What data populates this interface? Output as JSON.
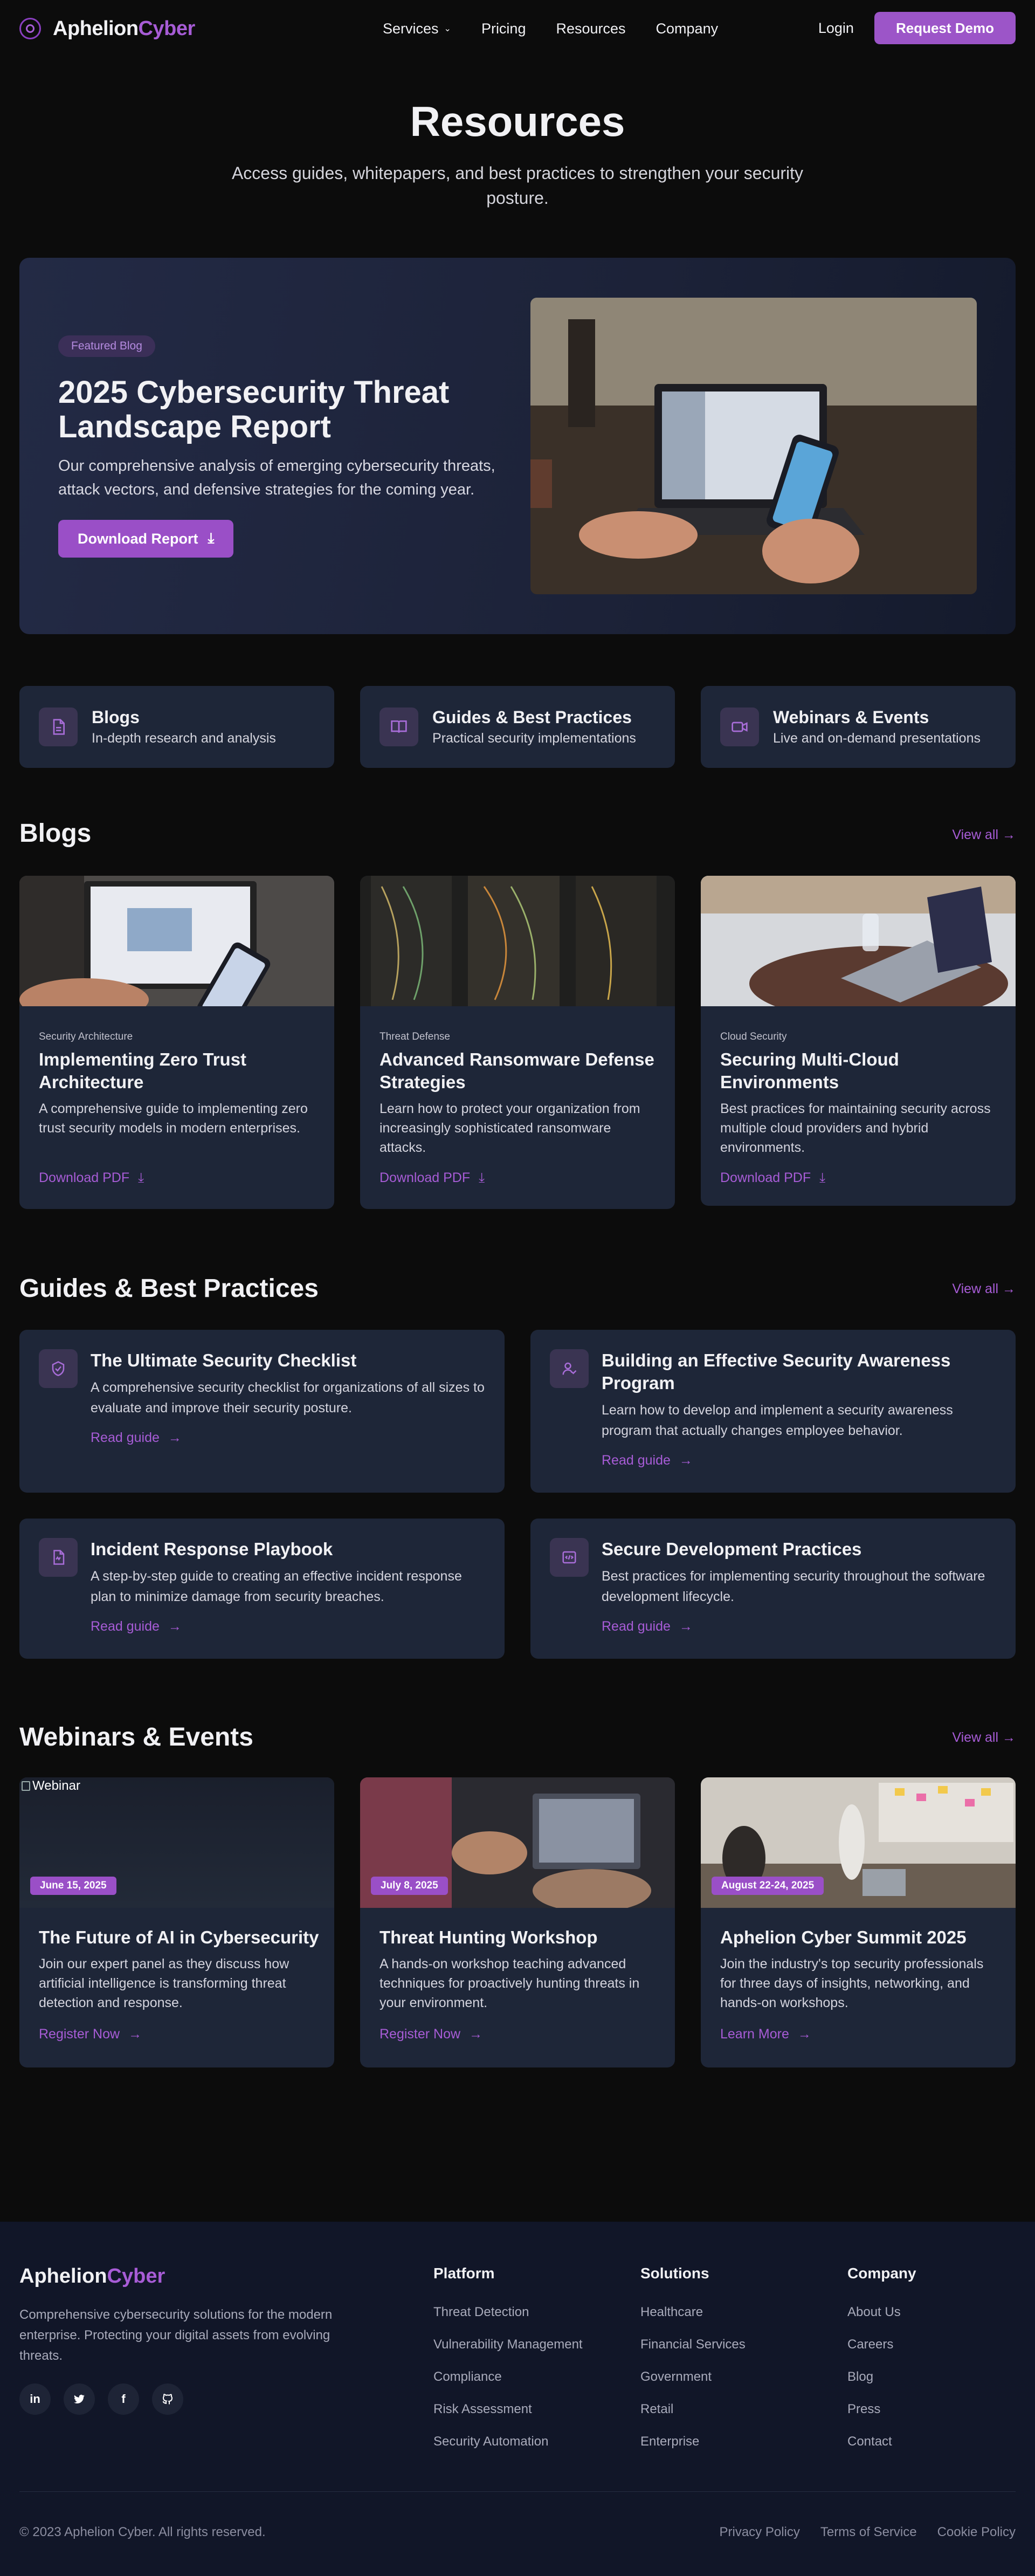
{
  "nav": {
    "brand_a": "Aphelion",
    "brand_b": "Cyber",
    "links": [
      "Services",
      "Pricing",
      "Resources",
      "Company"
    ],
    "login": "Login",
    "cta": "Request Demo"
  },
  "hero": {
    "title": "Resources",
    "subtitle": "Access guides, whitepapers, and best practices to strengthen your security posture."
  },
  "featured": {
    "badge": "Featured Blog",
    "title": "2025 Cybersecurity Threat Landscape Report",
    "description": "Our comprehensive analysis of emerging cybersecurity threats, attack vectors, and defensive strategies for the coming year.",
    "button": "Download Report"
  },
  "categories": [
    {
      "title": "Blogs",
      "subtitle": "In-depth research and analysis",
      "icon": "document-icon"
    },
    {
      "title": "Guides & Best Practices",
      "subtitle": "Practical security implementations",
      "icon": "book-icon"
    },
    {
      "title": "Webinars & Events",
      "subtitle": "Live and on-demand presentations",
      "icon": "video-icon"
    }
  ],
  "blogs": {
    "heading": "Blogs",
    "view_all": "View all",
    "items": [
      {
        "category": "Security Architecture",
        "title": "Implementing Zero Trust Architecture",
        "description": "A comprehensive guide to implementing zero trust security models in modern enterprises.",
        "link": "Download PDF"
      },
      {
        "category": "Threat Defense",
        "title": "Advanced Ransomware Defense Strategies",
        "description": "Learn how to protect your organization from increasingly sophisticated ransomware attacks.",
        "link": "Download PDF"
      },
      {
        "category": "Cloud Security",
        "title": "Securing Multi-Cloud Environments",
        "description": "Best practices for maintaining security across multiple cloud providers and hybrid environments.",
        "link": "Download PDF"
      }
    ]
  },
  "guides": {
    "heading": "Guides & Best Practices",
    "view_all": "View all",
    "items": [
      {
        "title": "The Ultimate Security Checklist",
        "description": "A comprehensive security checklist for organizations of all sizes to evaluate and improve their security posture.",
        "link": "Read guide",
        "icon": "shield-check-icon"
      },
      {
        "title": "Building an Effective Security Awareness Program",
        "description": "Learn how to develop and implement a security awareness program that actually changes employee behavior.",
        "link": "Read guide",
        "icon": "user-icon"
      },
      {
        "title": "Incident Response Playbook",
        "description": "A step-by-step guide to creating an effective incident response plan to minimize damage from security breaches.",
        "link": "Read guide",
        "icon": "file-icon"
      },
      {
        "title": "Secure Development Practices",
        "description": "Best practices for implementing security throughout the software development lifecycle.",
        "link": "Read guide",
        "icon": "code-icon"
      }
    ]
  },
  "events": {
    "heading": "Webinars & Events",
    "view_all": "View all",
    "items": [
      {
        "date": "June 15, 2025",
        "title": "The Future of AI in Cybersecurity",
        "description": "Join our expert panel as they discuss how artificial intelligence is transforming threat detection and response.",
        "link": "Register Now",
        "image_alt": "Webinar"
      },
      {
        "date": "July 8, 2025",
        "title": "Threat Hunting Workshop",
        "description": "A hands-on workshop teaching advanced techniques for proactively hunting threats in your environment.",
        "link": "Register Now"
      },
      {
        "date": "August 22-24, 2025",
        "title": "Aphelion Cyber Summit 2025",
        "description": "Join the industry's top security professionals for three days of insights, networking, and hands-on workshops.",
        "link": "Learn More"
      }
    ]
  },
  "footer": {
    "brand_a": "Aphelion",
    "brand_b": "Cyber",
    "description": "Comprehensive cybersecurity solutions for the modern enterprise. Protecting your digital assets from evolving threats.",
    "socials": [
      "in",
      "twitter",
      "f",
      "github"
    ],
    "columns": [
      {
        "title": "Platform",
        "links": [
          "Threat Detection",
          "Vulnerability Management",
          "Compliance",
          "Risk Assessment",
          "Security Automation"
        ]
      },
      {
        "title": "Solutions",
        "links": [
          "Healthcare",
          "Financial Services",
          "Government",
          "Retail",
          "Enterprise"
        ]
      },
      {
        "title": "Company",
        "links": [
          "About Us",
          "Careers",
          "Blog",
          "Press",
          "Contact"
        ]
      }
    ],
    "copyright": "© 2023 Aphelion Cyber. All rights reserved.",
    "legal": [
      "Privacy Policy",
      "Terms of Service",
      "Cookie Policy"
    ]
  },
  "colors": {
    "accent": "#9c55c8",
    "card": "#1e2638",
    "background": "#0c0c0c",
    "footer": "#111628"
  }
}
